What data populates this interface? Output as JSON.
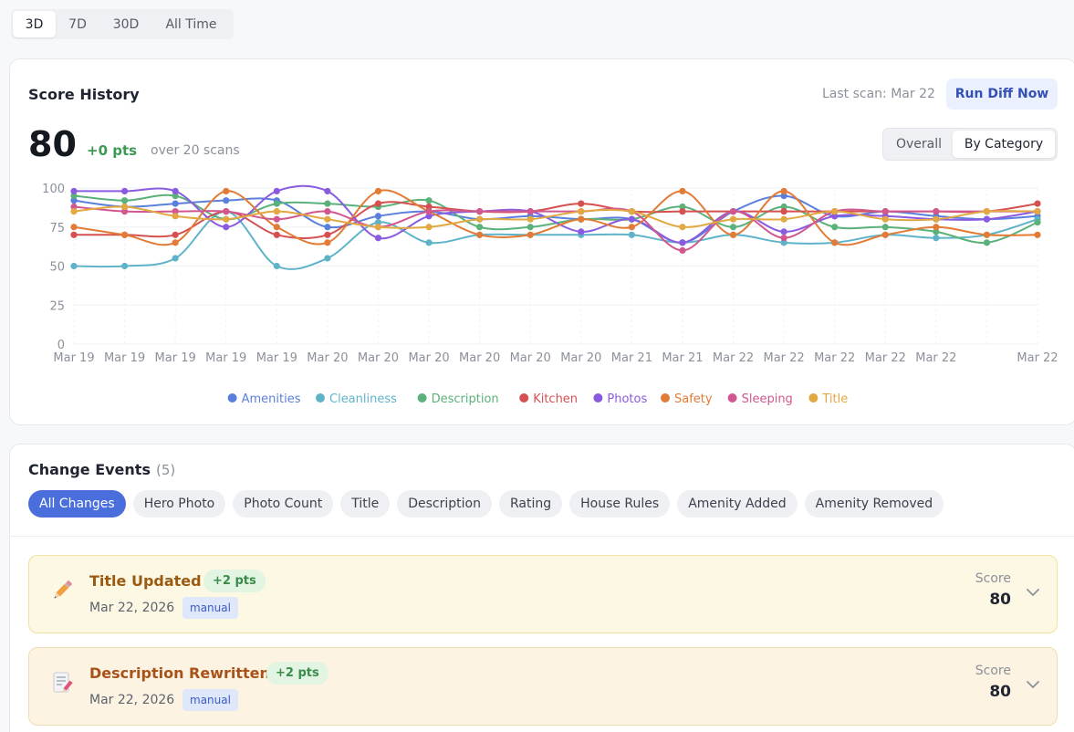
{
  "range_tabs": [
    "3D",
    "7D",
    "30D",
    "All Time"
  ],
  "score_history": {
    "title": "Score History",
    "last_scan": "Last scan: Mar 22",
    "run_button": "Run Diff Now",
    "score": "80",
    "delta": "+0 pts",
    "over": "over 20 scans",
    "view_options": [
      "Overall",
      "By Category"
    ]
  },
  "chart_data": {
    "type": "line",
    "ylim": [
      0,
      100
    ],
    "yticks": [
      0,
      25,
      50,
      75,
      100
    ],
    "x_labels": [
      "Mar 19",
      "Mar 19",
      "Mar 19",
      "Mar 19",
      "Mar 19",
      "Mar 20",
      "Mar 20",
      "Mar 20",
      "Mar 20",
      "Mar 20",
      "Mar 20",
      "Mar 21",
      "Mar 21",
      "Mar 22",
      "Mar 22",
      "Mar 22",
      "Mar 22",
      "Mar 22",
      "",
      "Mar 22"
    ],
    "grid": true,
    "legend": "bottom",
    "series": [
      {
        "name": "Amenities",
        "color": "#5b7fdc",
        "values": [
          92,
          88,
          90,
          92,
          92,
          75,
          82,
          85,
          80,
          82,
          80,
          80,
          65,
          85,
          95,
          82,
          85,
          82,
          80,
          82
        ]
      },
      {
        "name": "Cleanliness",
        "color": "#5fb3c9",
        "values": [
          50,
          50,
          55,
          85,
          50,
          55,
          78,
          65,
          70,
          70,
          70,
          70,
          65,
          70,
          65,
          65,
          70,
          68,
          70,
          80
        ]
      },
      {
        "name": "Description",
        "color": "#5ab17a",
        "values": [
          95,
          92,
          95,
          80,
          90,
          90,
          88,
          92,
          75,
          75,
          80,
          80,
          88,
          75,
          88,
          75,
          75,
          72,
          65,
          78
        ]
      },
      {
        "name": "Kitchen",
        "color": "#d65050",
        "values": [
          70,
          70,
          70,
          85,
          70,
          70,
          90,
          88,
          85,
          85,
          90,
          85,
          85,
          85,
          85,
          85,
          85,
          85,
          85,
          90
        ]
      },
      {
        "name": "Photos",
        "color": "#8a5be0",
        "values": [
          98,
          98,
          98,
          75,
          98,
          98,
          68,
          82,
          85,
          85,
          72,
          80,
          65,
          85,
          72,
          82,
          82,
          80,
          80,
          85
        ]
      },
      {
        "name": "Safety",
        "color": "#e27b35",
        "values": [
          75,
          70,
          65,
          98,
          75,
          65,
          98,
          85,
          70,
          70,
          80,
          75,
          98,
          70,
          98,
          65,
          70,
          75,
          70,
          70
        ]
      },
      {
        "name": "Sleeping",
        "color": "#d0588f",
        "values": [
          88,
          85,
          85,
          85,
          80,
          85,
          75,
          85,
          85,
          85,
          85,
          85,
          60,
          85,
          68,
          85,
          85,
          85,
          85,
          85
        ]
      },
      {
        "name": "Title",
        "color": "#e2a842",
        "values": [
          85,
          88,
          82,
          80,
          85,
          80,
          75,
          75,
          80,
          80,
          85,
          85,
          75,
          80,
          80,
          85,
          80,
          80,
          85,
          85
        ]
      }
    ]
  },
  "change_events": {
    "title": "Change Events",
    "count": "(5)",
    "filters": [
      "All Changes",
      "Hero Photo",
      "Photo Count",
      "Title",
      "Description",
      "Rating",
      "House Rules",
      "Amenity Added",
      "Amenity Removed"
    ],
    "items": [
      {
        "title": "Title Updated",
        "pts": "+2 pts",
        "date": "Mar 22, 2026",
        "tag": "manual",
        "score_label": "Score",
        "score": "80",
        "icon": "pencil-icon"
      },
      {
        "title": "Description Rewritten",
        "pts": "+2 pts",
        "date": "Mar 22, 2026",
        "tag": "manual",
        "score_label": "Score",
        "score": "80",
        "icon": "document-edit-icon"
      }
    ]
  }
}
